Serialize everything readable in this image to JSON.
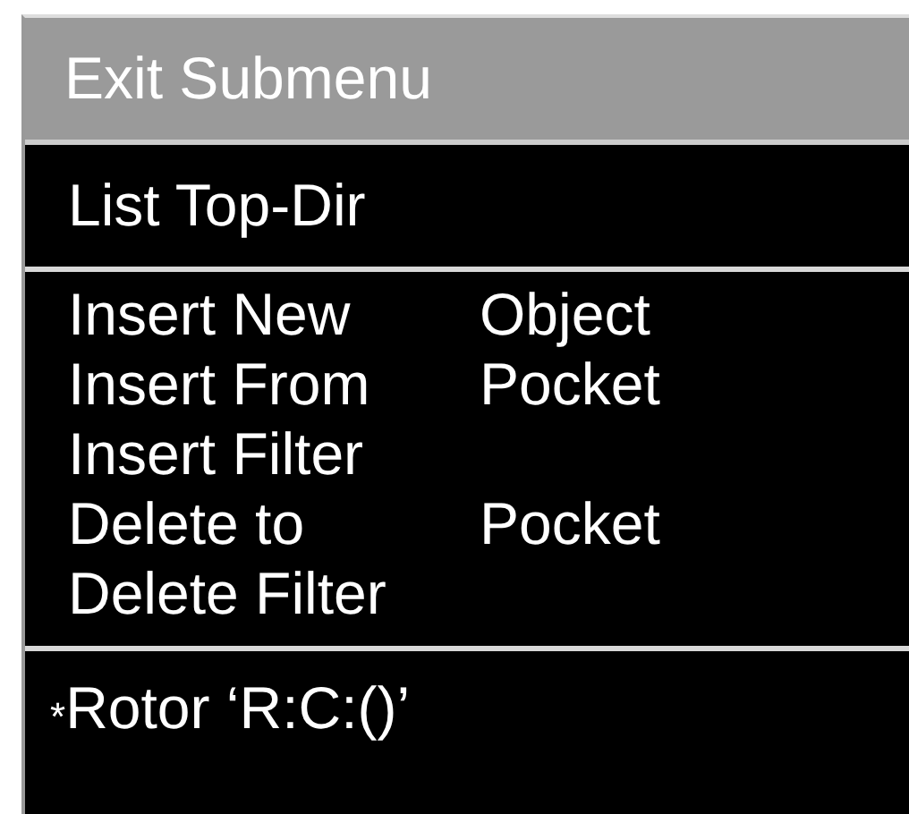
{
  "header": {
    "title": "Exit Submenu"
  },
  "top_item": {
    "label": "List Top-Dir"
  },
  "items": [
    {
      "action": "Insert New",
      "target": "Object"
    },
    {
      "action": "Insert From",
      "target": "Pocket"
    },
    {
      "action": "Insert Filter"
    },
    {
      "action": "Delete to",
      "target": "Pocket"
    },
    {
      "action": "Delete Filter"
    }
  ],
  "footer": {
    "marker": "*",
    "label": "Rotor ‘R:C:()’"
  }
}
